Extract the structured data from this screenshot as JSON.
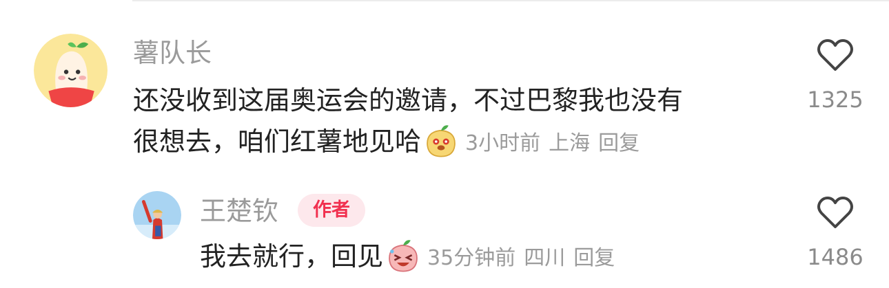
{
  "comments": [
    {
      "username": "薯队长",
      "text_line1": "还没收到这届奥运会的邀请，不过巴黎我也没有",
      "text_line2": "很想去，咱们红薯地见哈",
      "time": "3小时前",
      "location": "上海",
      "reply_label": "回复",
      "likes": "1325",
      "avatar_icon": "potato-mascot-avatar",
      "emoji_icon": "potato-mascot-emoji"
    },
    {
      "username": "王楚钦",
      "badge": "作者",
      "text": "我去就行，回见",
      "time": "35分钟前",
      "location": "四川",
      "reply_label": "回复",
      "likes": "1486",
      "avatar_icon": "anime-character-avatar",
      "emoji_icon": "laughing-potato-emoji"
    }
  ],
  "colors": {
    "username": "#9a9a9a",
    "body_text": "#222222",
    "meta": "#9b9b9b",
    "badge_text": "#f1304f",
    "badge_bg": "#fde8ec"
  }
}
